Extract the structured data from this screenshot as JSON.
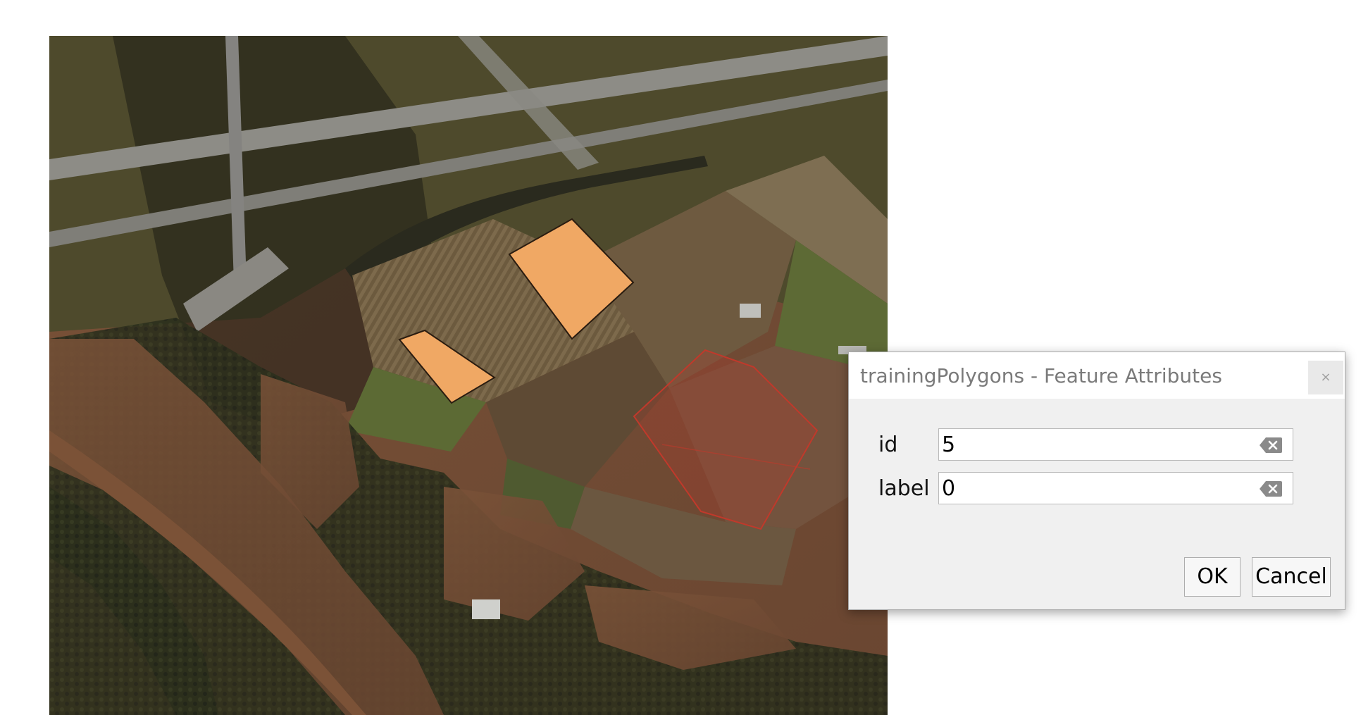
{
  "map": {
    "layer_colors": {
      "water": "#6e4a33",
      "forest": "#2b2e1a",
      "field_light": "#8c7a5a",
      "field_dark": "#5a4630",
      "runway": "#8a8a86",
      "polygon_fill": "#f0a864",
      "polygon_stroke": "#2a1c10",
      "selected_polygon": "#c0392b"
    },
    "polygon_count": 3,
    "selected_polygon_index": 3
  },
  "dialog": {
    "title": "trainingPolygons - Feature Attributes",
    "close_glyph": "×",
    "fields": [
      {
        "label": "id",
        "value": "5"
      },
      {
        "label": "label",
        "value": "0"
      }
    ],
    "ok_label": "OK",
    "cancel_label": "Cancel"
  }
}
